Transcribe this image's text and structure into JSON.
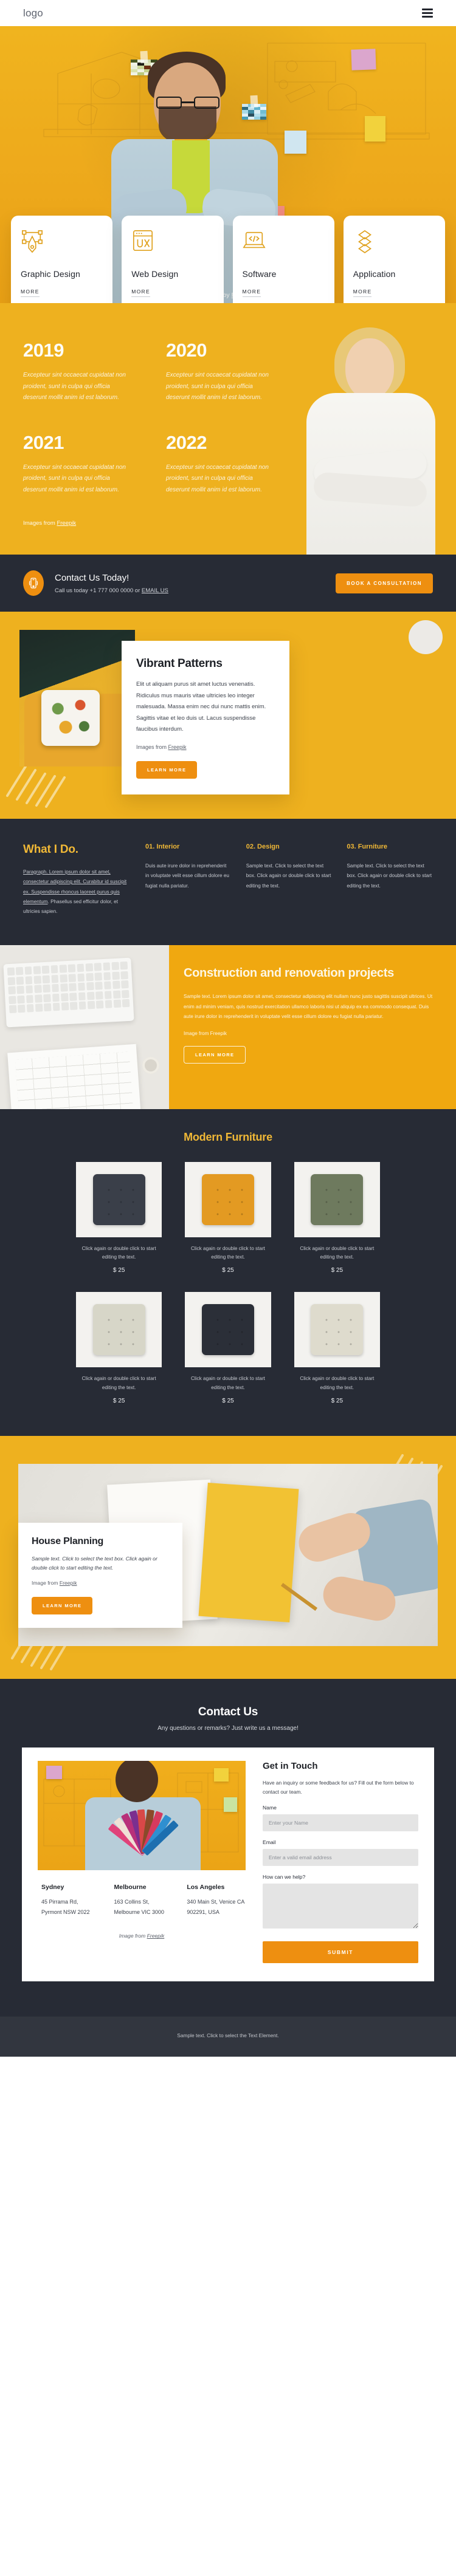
{
  "header": {
    "logo": "logo",
    "menu_icon": "hamburger-menu"
  },
  "hero": {
    "credit_prefix": "Image by ",
    "credit_link": "Freepik",
    "cards": [
      {
        "icon": "pen-tool-icon",
        "title": "Graphic Design",
        "more": "MORE"
      },
      {
        "icon": "ux-browser-icon",
        "title": "Web Design",
        "more": "MORE"
      },
      {
        "icon": "code-laptop-icon",
        "title": "Software",
        "more": "MORE"
      },
      {
        "icon": "stacked-layers-icon",
        "title": "Application",
        "more": "MORE"
      }
    ]
  },
  "years": {
    "items": [
      {
        "year": "2019",
        "text": "Excepteur sint occaecat cupidatat non proident, sunt in culpa qui officia deserunt mollit anim id est laborum."
      },
      {
        "year": "2020",
        "text": "Excepteur sint occaecat cupidatat non proident, sunt in culpa qui officia deserunt mollit anim id est laborum."
      },
      {
        "year": "2021",
        "text": "Excepteur sint occaecat cupidatat non proident, sunt in culpa qui officia deserunt mollit anim id est laborum."
      },
      {
        "year": "2022",
        "text": "Excepteur sint occaecat cupidatat non proident, sunt in culpa qui officia deserunt mollit anim id est laborum."
      }
    ],
    "credit_prefix": "Images from ",
    "credit_link": "Freepik"
  },
  "contact_bar": {
    "icon": "mobile-phone-ringing-icon",
    "title": "Contact Us Today!",
    "subtitle_prefix": "Call us today +1 777 000 0000 or ",
    "subtitle_link": "EMAIL US",
    "button": "BOOK A CONSULTATION"
  },
  "vibrant": {
    "title": "Vibrant Patterns",
    "body": "Elit ut aliquam purus sit amet luctus venenatis. Ridiculus mus mauris vitae ultricies leo integer malesuada. Massa enim nec dui nunc mattis enim. Sagittis vitae et leo duis ut. Lacus suspendisse faucibus interdum.",
    "credit_prefix": "Images from ",
    "credit_link": "Freepik",
    "button": "LEARN MORE"
  },
  "whatido": {
    "heading": "What I Do.",
    "intro_a": "Paragraph. Lorem ipsum dolor sit amet, consectetur adipiscing elit. Curabitur id suscipit ex. Suspendisse rhoncus laoreet purus quis elementum",
    "intro_link": ". Phasellus sed efficitur dolor, et ultricies sapien.",
    "columns": [
      {
        "title": "01. Interior",
        "text": "Duis aute irure dolor in reprehenderit in voluptate velit esse cillum dolore eu fugiat nulla pariatur."
      },
      {
        "title": "02.  Design",
        "text": "Sample text. Click to select the text box. Click again or double click to start editing the text."
      },
      {
        "title": "03. Furniture",
        "text": "Sample text. Click to select the text box. Click again or double click to start editing the text."
      }
    ]
  },
  "construction": {
    "title": "Construction and renovation projects",
    "body": "Sample text. Lorem ipsum dolor sit amet, consectetur adipiscing elit nullam nunc justo sagittis suscipit ultrices. Ut enim ad minim veniam, quis nostrud exercitation ullamco laboris nisi ut aliquip ex ea commodo consequat. Duis aute irure dolor in reprehenderit in voluptate velit esse cillum dolore eu fugiat nulla pariatur.",
    "credit": "Image from Freepik",
    "button": "LEARN MORE"
  },
  "furniture": {
    "title": "Modern Furniture",
    "items": [
      {
        "color": "#3a3f49",
        "caption": "Click again or double click to start editing the text.",
        "price": "$ 25"
      },
      {
        "color": "#e39a22",
        "caption": "Click again or double click to start editing the text.",
        "price": "$ 25"
      },
      {
        "color": "#6e7a5e",
        "caption": "Click again or double click to start editing the text.",
        "price": "$ 25"
      },
      {
        "color": "#d7d6c8",
        "caption": "Click again or double click to start editing the text.",
        "price": "$ 25"
      },
      {
        "color": "#2b2f38",
        "caption": "Click again or double click to start editing the text.",
        "price": "$ 25"
      },
      {
        "color": "#dedbcd",
        "caption": "Click again or double click to start editing the text.",
        "price": "$ 25"
      }
    ]
  },
  "house": {
    "title": "House Planning",
    "body": "Sample text. Click to select the text box. Click again or double click to start editing the text.",
    "credit_prefix": "Image from ",
    "credit_link": "Freepik",
    "button": "LEARN MORE"
  },
  "contact": {
    "heading": "Contact Us",
    "subheading": "Any questions or remarks? Just write us a message!",
    "form_title": "Get in Touch",
    "form_intro": "Have an inquiry or some feedback for us? Fill out the form below to contact our team.",
    "fields": [
      {
        "label": "Name",
        "placeholder": "Enter your Name",
        "value": ""
      },
      {
        "label": "Email",
        "placeholder": "Enter a valid email address",
        "value": ""
      }
    ],
    "message_label": "How can we help?",
    "message_placeholder": "",
    "submit": "SUBMIT",
    "cities": [
      {
        "name": "Sydney",
        "address": "45 Pirrama Rd, Pyrmont NSW 2022"
      },
      {
        "name": "Melbourne",
        "address": "163 Collins St, Melbourne VIC 3000"
      },
      {
        "name": "Los Angeles",
        "address": "340 Main St, Venice CA 902291, USA"
      }
    ],
    "credit_prefix": "Image from ",
    "credit_link": "Freepik"
  },
  "footer": {
    "text": "Sample text. Click to select the Text Element."
  },
  "colors": {
    "yellow": "#eeb11f",
    "orange": "#ee8f10",
    "dark": "#272b35",
    "gold": "#f0b836"
  }
}
